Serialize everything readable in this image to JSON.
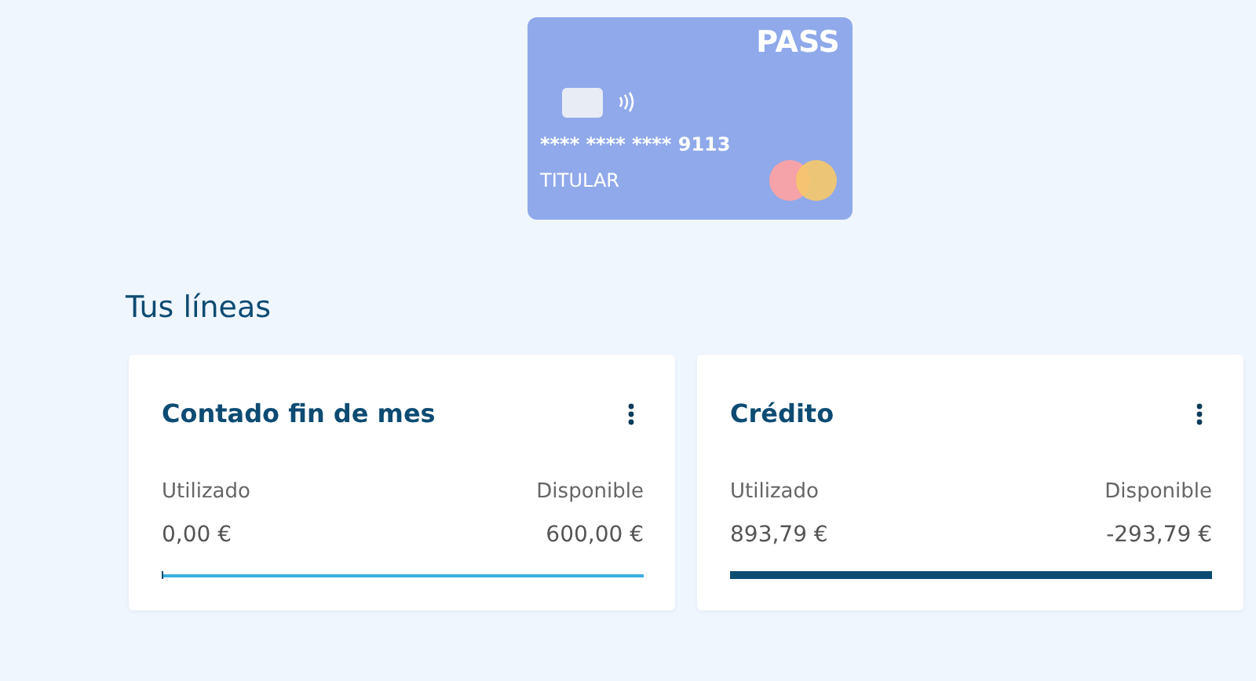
{
  "bank_card": {
    "brand": "PASS",
    "number": "**** **** **** 9113",
    "holder": "TITULAR"
  },
  "section_title": "Tus líneas",
  "lines": [
    {
      "title": "Contado fin de mes",
      "used_label": "Utilizado",
      "available_label": "Disponible",
      "used": "0,00 €",
      "available": "600,00 €",
      "level": 0
    },
    {
      "title": "Crédito",
      "used_label": "Utilizado",
      "available_label": "Disponible",
      "used": "893,79 €",
      "available": "-293,79 €",
      "level": 1
    }
  ]
}
